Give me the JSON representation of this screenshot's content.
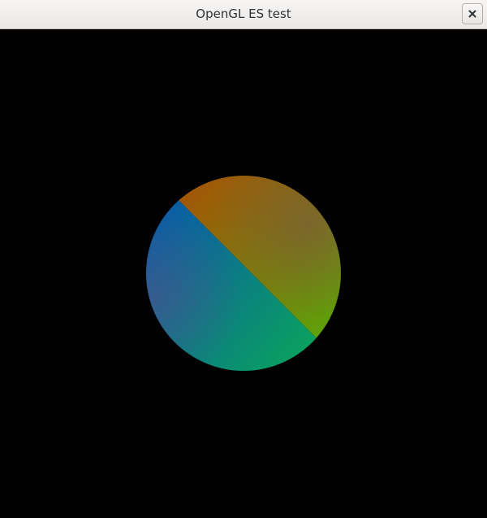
{
  "window": {
    "title": "OpenGL ES test",
    "close_icon": "close-icon"
  },
  "scene": {
    "background": "#000000",
    "colors": {
      "blue": "#0a5fa3",
      "orange": "#a35408",
      "green": "#0aa35c",
      "lime": "#5ca30a",
      "center": "#3d7a4a",
      "purple_edge": "#4a4e8a",
      "brown_edge": "#7a5040"
    }
  }
}
